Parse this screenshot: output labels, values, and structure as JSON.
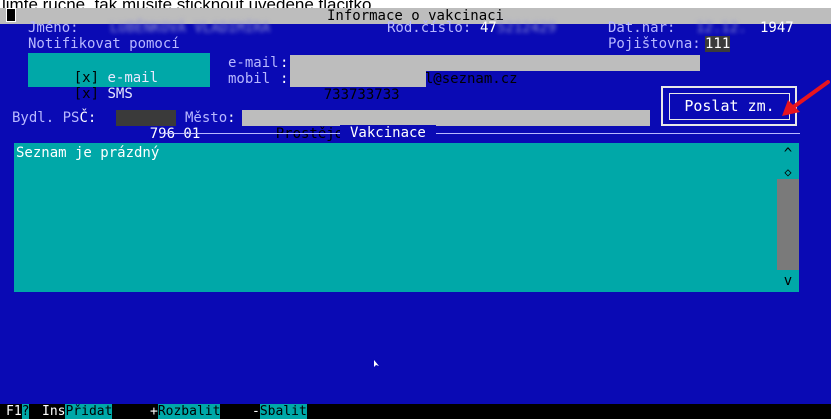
{
  "caption_partial": "limte rucne, tak musite sticknout uvedene tlacitko.",
  "window": {
    "title": "Informace o vakcinaci"
  },
  "patient": {
    "name_label": "Jméno:",
    "name_value": "LUBĚNKOVÁ VLADIMÍRA",
    "rc_label": "Rod.číslo:",
    "rc_visible": "47",
    "rc_blurred": "5212429",
    "birth_label": "Dat.nar:",
    "birth_blurred": "12.12.",
    "birth_year": "1947",
    "insurer_label": "Pojištovna:",
    "insurer_value": "111"
  },
  "notify": {
    "label": "Notifikovat pomocí",
    "email_check": "[x]",
    "email_hot": "e",
    "email_rest": "-mail",
    "sms_check": "[x]",
    "sms_hot": "S",
    "sms_rest": "MS",
    "email_label": "e-mail",
    "email_sep": ":",
    "email_value": "pacientuvmail@seznam.cz",
    "mobile_label": "mobil ",
    "mobile_sep": ":",
    "mobile_value": "733733733"
  },
  "address": {
    "bydl_label": "Bydl. PS",
    "bydl_label2": "Č",
    "bydl_colon": ":",
    "psc_value": "796 01",
    "city_label": "Město",
    "city_colon": ":",
    "city_value": "Prostějov"
  },
  "send_button": {
    "label": "Poslat zm."
  },
  "vaccination": {
    "section_title": "Vakcinace",
    "empty_text": "Seznam je prázdný",
    "scroll_up": "^",
    "scroll_thumb": "◇",
    "scroll_down": "v"
  },
  "status_bar": {
    "f1_key": "F1",
    "f1_box": "?",
    "ins_key": "Ins",
    "ins_action": "Přidat",
    "plus_key": "+",
    "plus_action": "Rozbalit",
    "minus_key": "-",
    "minus_action": "Sbalit"
  },
  "colors": {
    "screen_bg": "#0a0ab4",
    "teal": "#00a8a8",
    "field_gray": "#bdbdbd",
    "arrow_red": "#e8141e"
  }
}
